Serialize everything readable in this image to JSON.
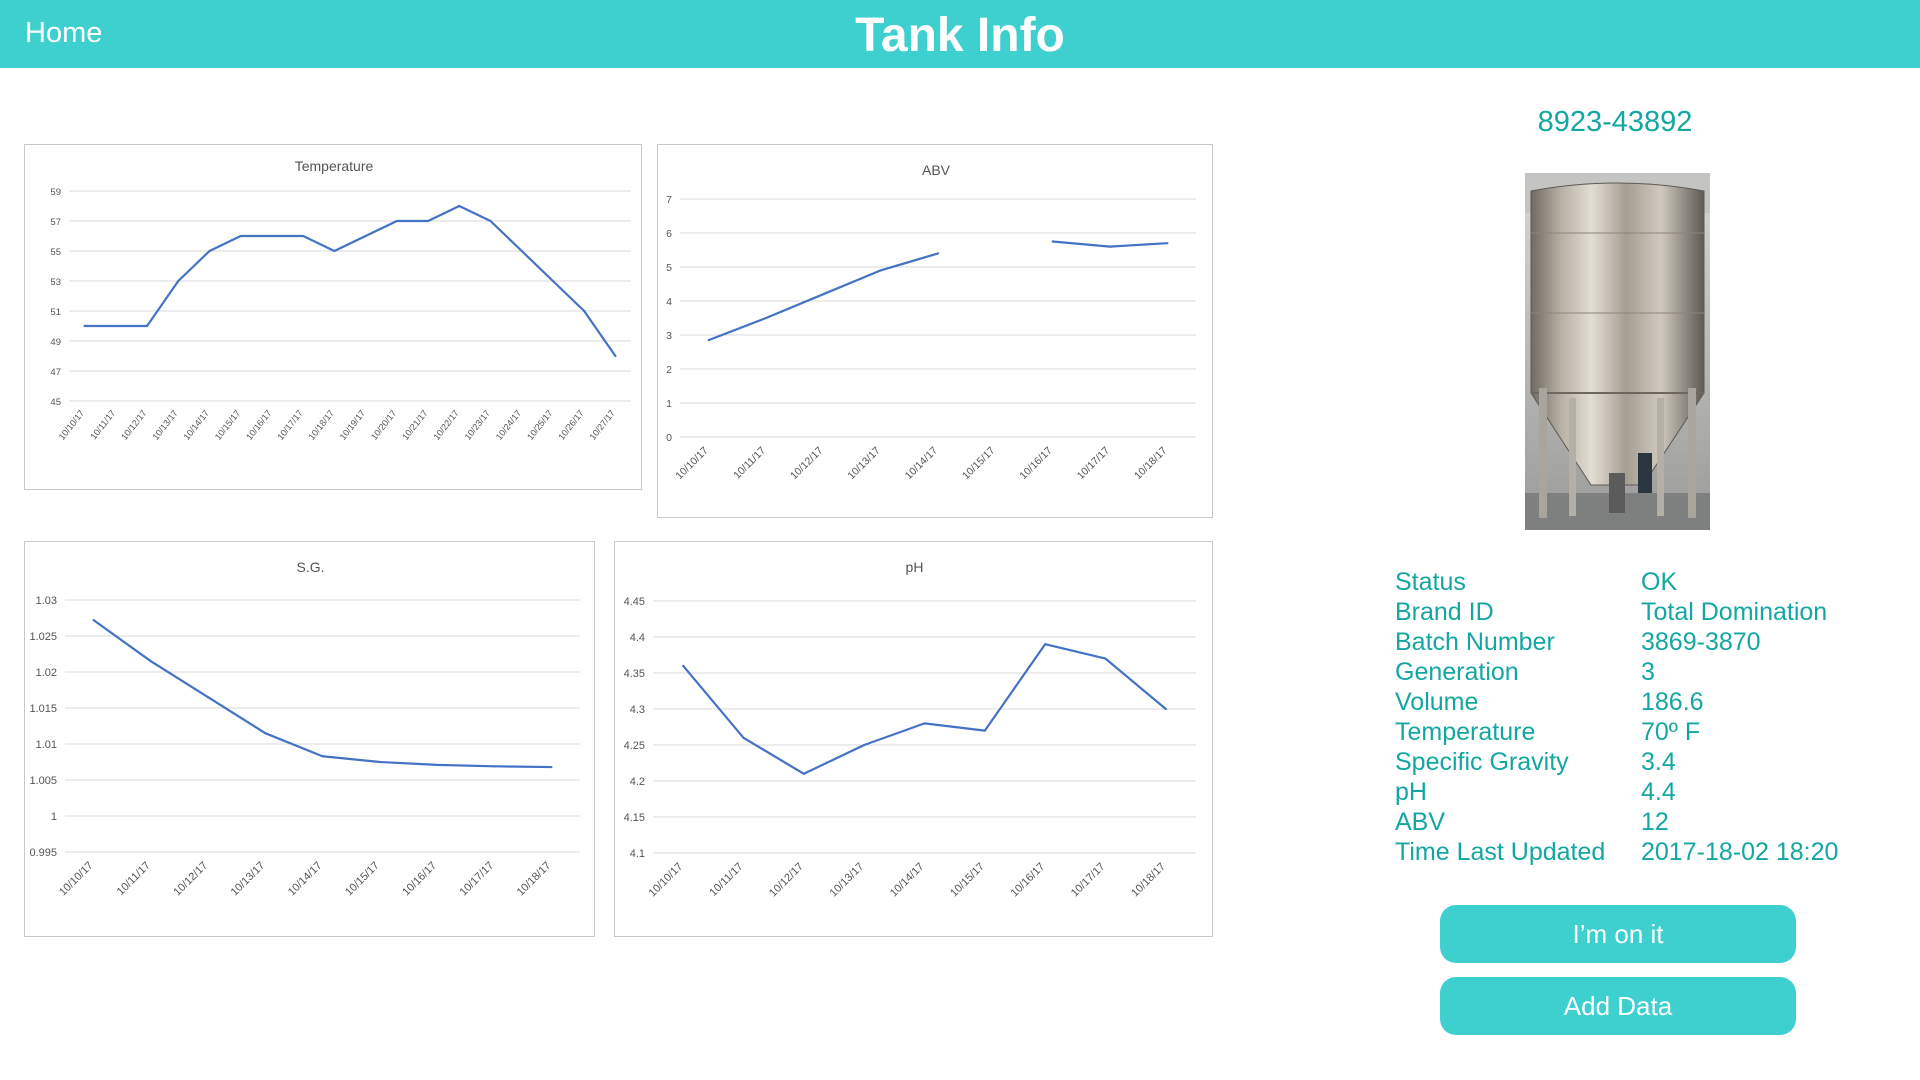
{
  "header": {
    "home_label": "Home",
    "title": "Tank Info"
  },
  "tank": {
    "id": "8923-43892",
    "info": [
      {
        "label": "Status",
        "value": "OK"
      },
      {
        "label": "Brand ID",
        "value": "Total Domination"
      },
      {
        "label": "Batch Number",
        "value": "3869-3870"
      },
      {
        "label": "Generation",
        "value": "3"
      },
      {
        "label": "Volume",
        "value": "186.6"
      },
      {
        "label": "Temperature",
        "value": "70º F"
      },
      {
        "label": "Specific Gravity",
        "value": "3.4"
      },
      {
        "label": "pH",
        "value": "4.4"
      },
      {
        "label": "ABV",
        "value": "12"
      },
      {
        "label": "Time Last Updated",
        "value": "2017-18-02 18:20"
      }
    ]
  },
  "buttons": {
    "on_it": "I’m on it",
    "add_data": "Add Data"
  },
  "colors": {
    "accent": "#3ecfcf",
    "text_accent": "#14a7a2",
    "series": "#4472c4"
  },
  "chart_data": [
    {
      "type": "line",
      "title": "Temperature",
      "categories": [
        "10/10/17",
        "10/11/17",
        "10/12/17",
        "10/13/17",
        "10/14/17",
        "10/15/17",
        "10/16/17",
        "10/17/17",
        "10/18/17",
        "10/19/17",
        "10/20/17",
        "10/21/17",
        "10/22/17",
        "10/23/17",
        "10/24/17",
        "10/25/17",
        "10/26/17",
        "10/27/17"
      ],
      "values": [
        50,
        50,
        50,
        53,
        55,
        56,
        56,
        56,
        55,
        56,
        57,
        57,
        58,
        57,
        55,
        53,
        51,
        48
      ],
      "ylim": [
        45,
        59
      ],
      "yticks": [
        "45",
        "47",
        "49",
        "51",
        "53",
        "55",
        "57",
        "59"
      ],
      "grid": true
    },
    {
      "type": "line",
      "title": "ABV",
      "categories": [
        "10/10/17",
        "10/11/17",
        "10/12/17",
        "10/13/17",
        "10/14/17",
        "10/15/17",
        "10/16/17",
        "10/17/17",
        "10/18/17"
      ],
      "values": [
        2.85,
        3.5,
        4.2,
        4.9,
        5.4,
        null,
        5.75,
        5.6,
        5.7
      ],
      "ylim": [
        0,
        7
      ],
      "yticks": [
        "0",
        "1",
        "2",
        "3",
        "4",
        "5",
        "6",
        "7"
      ],
      "grid": true
    },
    {
      "type": "line",
      "title": "S.G.",
      "categories": [
        "10/10/17",
        "10/11/17",
        "10/12/17",
        "10/13/17",
        "10/14/17",
        "10/15/17",
        "10/16/17",
        "10/17/17",
        "10/18/17"
      ],
      "values": [
        1.0272,
        1.0215,
        1.0165,
        1.0115,
        1.0083,
        1.0075,
        1.0071,
        1.0069,
        1.0068
      ],
      "ylim": [
        0.995,
        1.03
      ],
      "yticks": [
        "0.995",
        "1",
        "1.005",
        "1.01",
        "1.015",
        "1.02",
        "1.025",
        "1.03"
      ],
      "grid": true
    },
    {
      "type": "line",
      "title": "pH",
      "categories": [
        "10/10/17",
        "10/11/17",
        "10/12/17",
        "10/13/17",
        "10/14/17",
        "10/15/17",
        "10/16/17",
        "10/17/17",
        "10/18/17"
      ],
      "values": [
        4.36,
        4.26,
        4.21,
        4.25,
        4.28,
        4.27,
        4.39,
        4.37,
        4.3
      ],
      "ylim": [
        4.1,
        4.45
      ],
      "yticks": [
        "4.1",
        "4.15",
        "4.2",
        "4.25",
        "4.3",
        "4.35",
        "4.4",
        "4.45"
      ],
      "grid": true
    }
  ]
}
